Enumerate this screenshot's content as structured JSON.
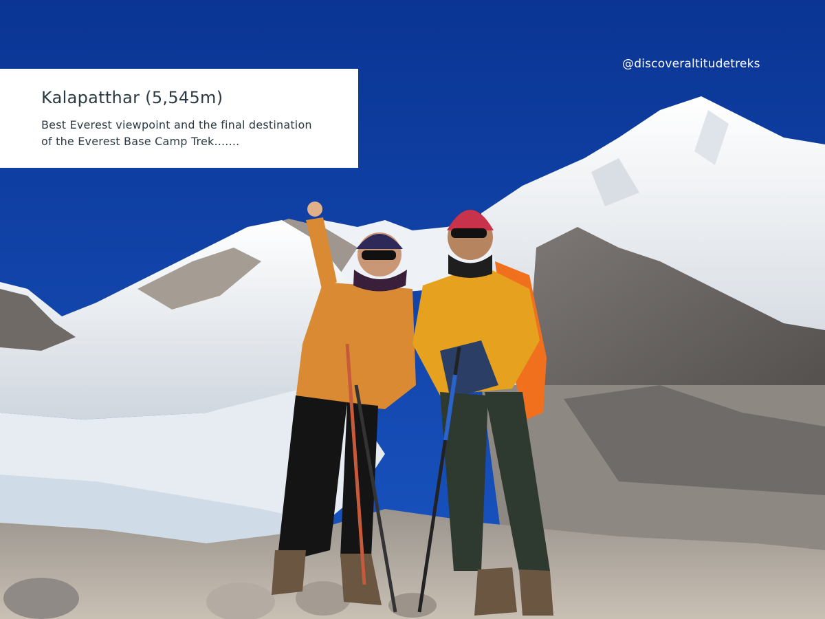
{
  "caption": {
    "title": "Kalapatthar (5,545m)",
    "description_lines": [
      "Best Everest viewpoint and the final destination",
      "of the Everest Base Camp Trek......."
    ]
  },
  "watermark": {
    "handle": "@discoveraltitudetreks"
  },
  "colors": {
    "sky": "#0d3fa8",
    "snow": "#eef2f6",
    "rock": "#8a8581",
    "jacket_left": "#d98a33",
    "jacket_right": "#e6a11f",
    "backpack": "#f0701e",
    "caption_bg": "#ffffff",
    "caption_text": "#2b3a40"
  }
}
